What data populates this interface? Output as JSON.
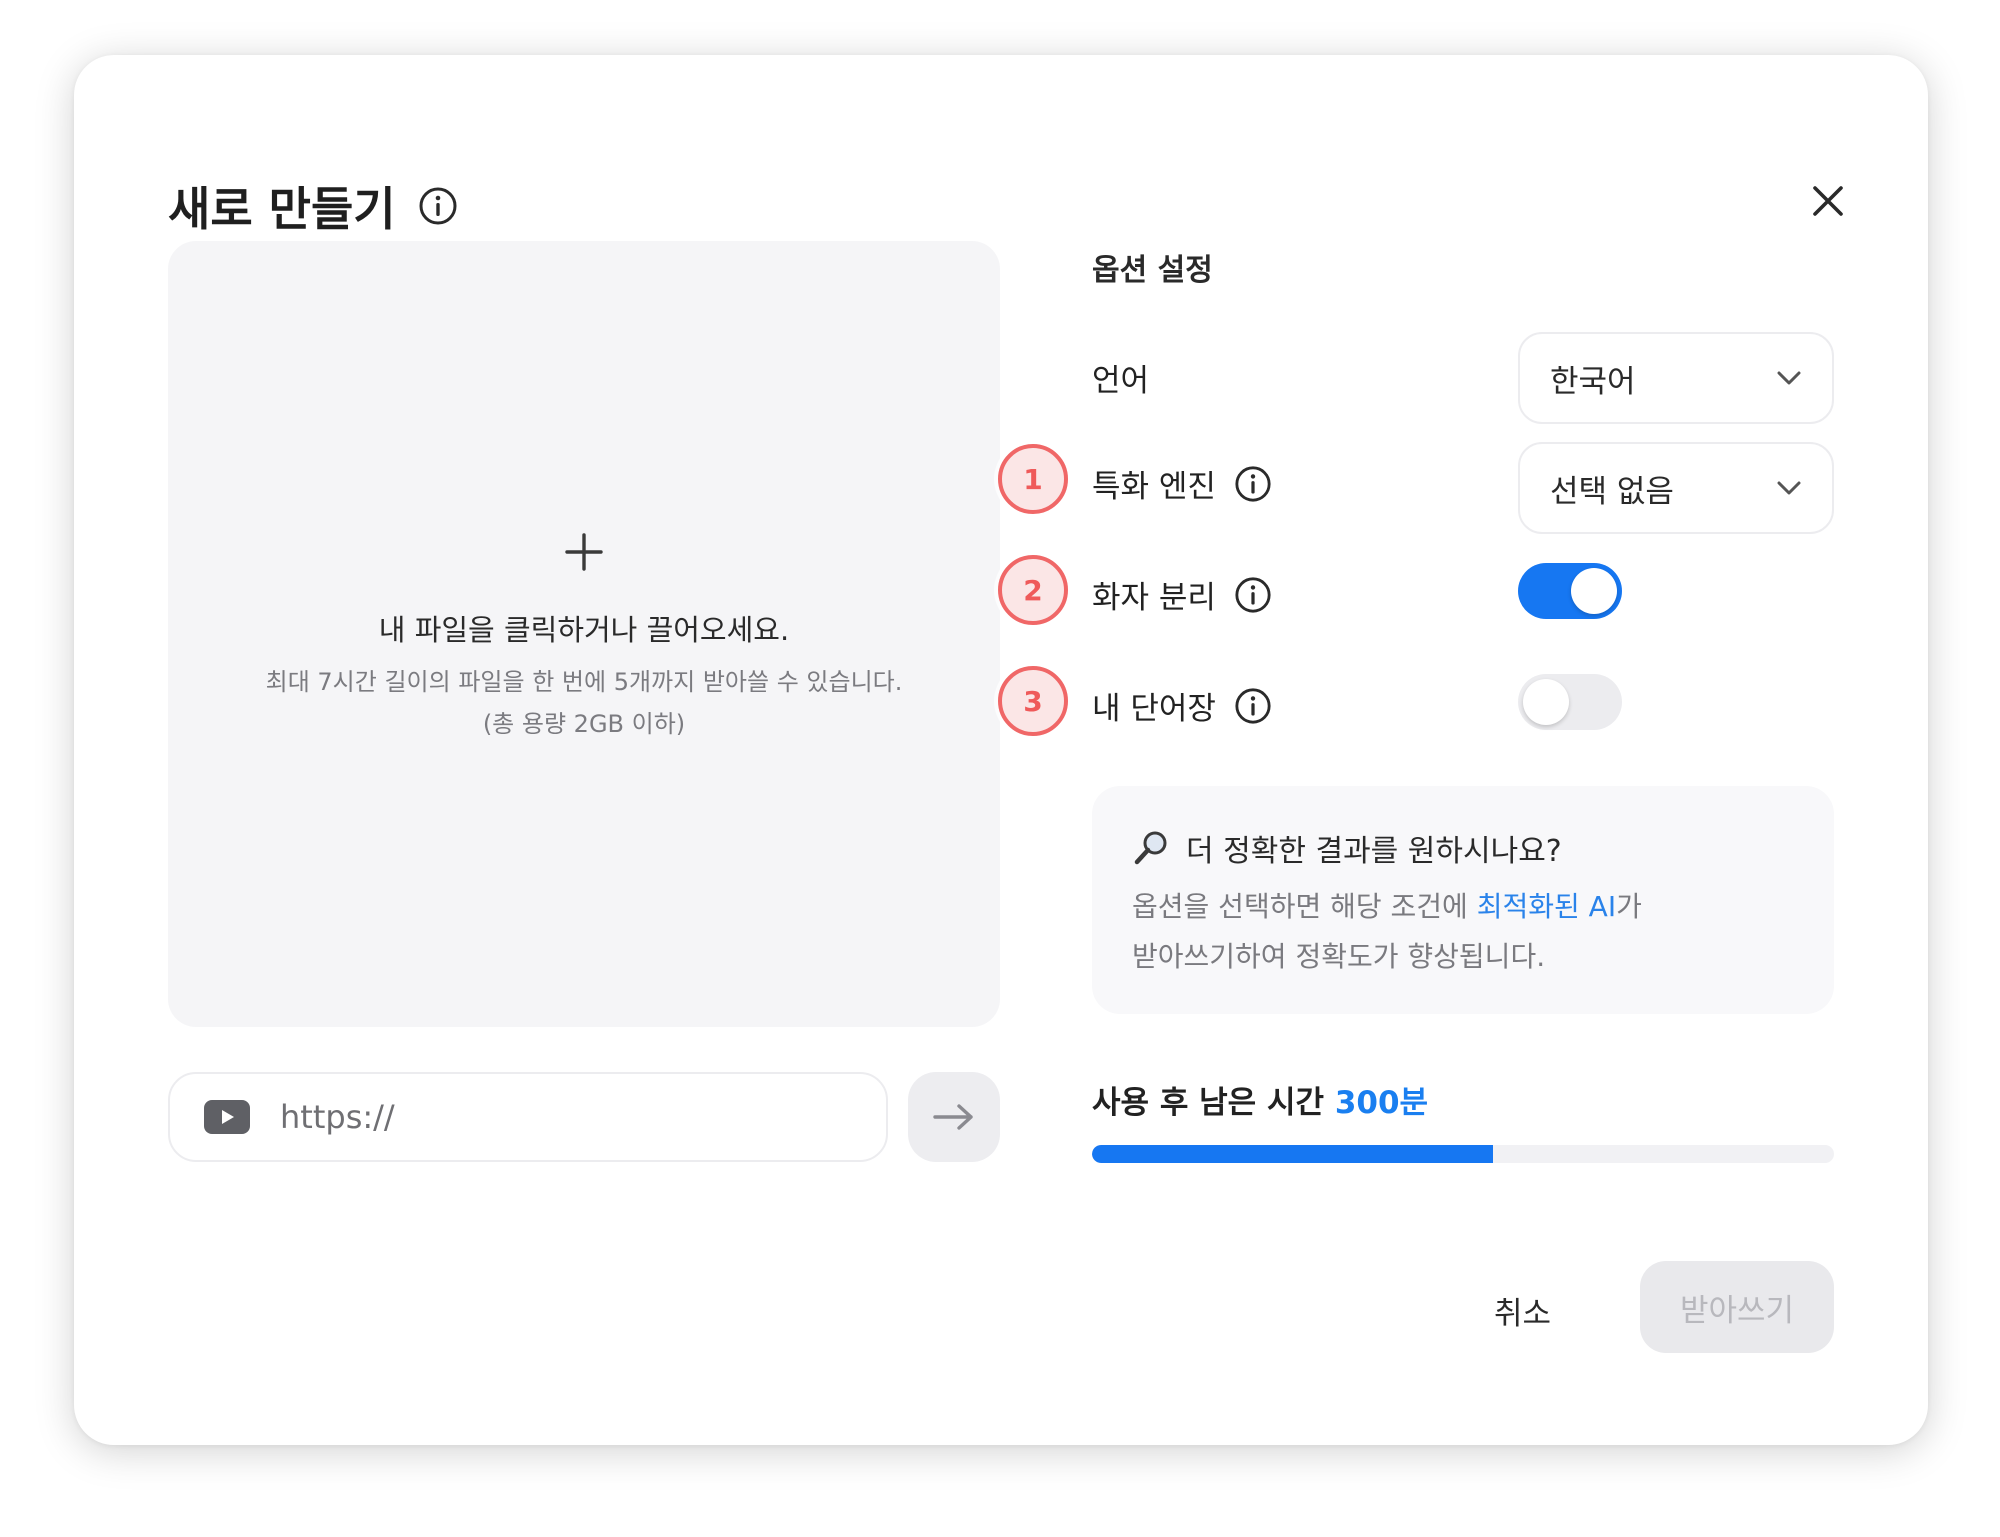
{
  "dialog": {
    "title": "새로 만들기"
  },
  "dropzone": {
    "main_text": "내 파일을 클릭하거나 끌어오세요.",
    "sub_text_line1": "최대 7시간 길이의 파일을 한 번에 5개까지 받아쓸 수 있습니다.",
    "sub_text_line2": "(총 용량 2GB 이하)"
  },
  "url_input": {
    "placeholder": "https://"
  },
  "options": {
    "title": "옵션 설정",
    "language": {
      "label": "언어",
      "value": "한국어"
    },
    "engine": {
      "badge": "1",
      "label": "특화 엔진",
      "value": "선택 없음"
    },
    "speaker": {
      "badge": "2",
      "label": "화자 분리",
      "enabled": true
    },
    "vocabulary": {
      "badge": "3",
      "label": "내 단어장",
      "enabled": false
    }
  },
  "hint": {
    "title": "더 정확한 결과를 원하시나요?",
    "body_before": "옵션을 선택하면 해당 조건에 ",
    "body_accent": "최적화된 AI",
    "body_after_line1": "가",
    "body_line2": "받아쓰기하여 정확도가 향상됩니다."
  },
  "remaining": {
    "label": "사용 후 남은 시간 ",
    "value": "300분",
    "progress_fraction": 0.54
  },
  "footer": {
    "cancel_label": "취소",
    "submit_label": "받아쓰기"
  },
  "colors": {
    "accent": "#1677f2",
    "badge": "#f06767",
    "toggle_on": "#1677f2",
    "toggle_off": "#ececef"
  }
}
